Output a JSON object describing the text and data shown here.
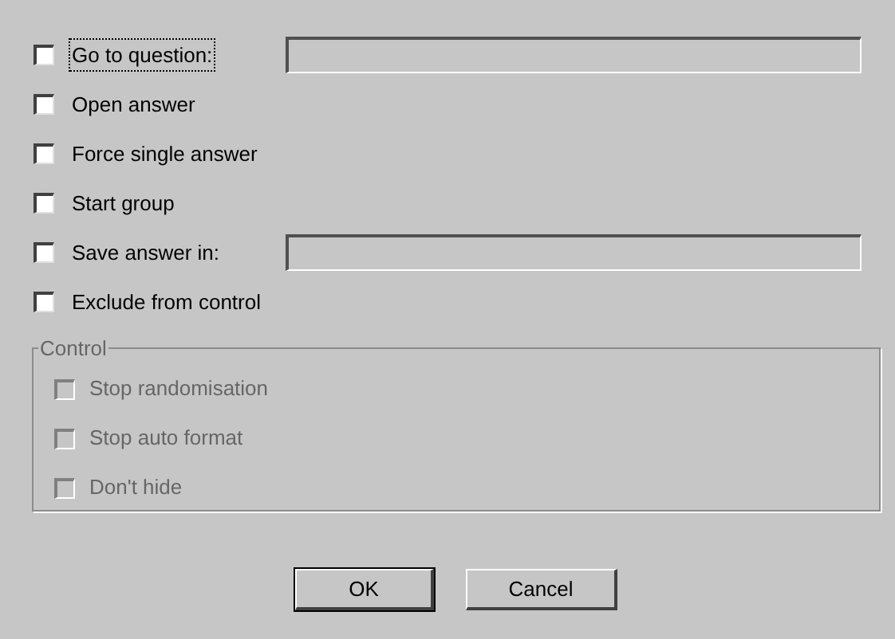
{
  "options": [
    {
      "kind": "field",
      "label": "Go to question:",
      "checked": false,
      "focused": true
    },
    {
      "kind": "plain",
      "label": "Open answer",
      "checked": false,
      "focused": false
    },
    {
      "kind": "plain",
      "label": "Force single answer",
      "checked": false,
      "focused": false
    },
    {
      "kind": "plain",
      "label": "Start group",
      "checked": false,
      "focused": false
    },
    {
      "kind": "field",
      "label": "Save answer in:",
      "checked": false,
      "focused": false
    },
    {
      "kind": "plain",
      "label": "Exclude from control",
      "checked": false,
      "focused": false
    }
  ],
  "control_group": {
    "title": "Control",
    "disabled": true,
    "items": [
      {
        "label": "Stop randomisation",
        "checked": false,
        "disabled": true
      },
      {
        "label": "Stop auto format",
        "checked": false,
        "disabled": true
      },
      {
        "label": "Don't hide",
        "checked": false,
        "disabled": true
      }
    ]
  },
  "buttons": [
    {
      "label": "OK",
      "default": true
    },
    {
      "label": "Cancel",
      "default": false
    }
  ]
}
